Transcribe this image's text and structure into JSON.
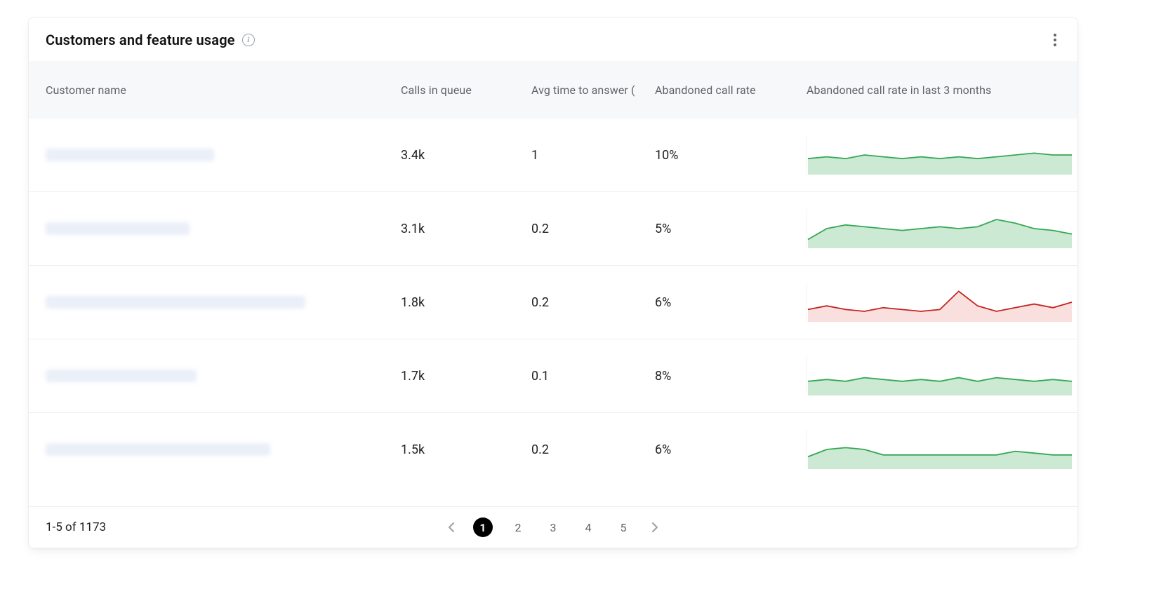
{
  "card": {
    "title": "Customers and feature usage",
    "columns": {
      "name": "Customer name",
      "calls": "Calls in queue",
      "avg": "Avg time to answer (",
      "rate": "Abandoned call rate",
      "chart": "Abandoned call rate in last 3 months"
    }
  },
  "rows": [
    {
      "name_blur_width": 240,
      "calls": "3.4k",
      "avg_answer": "1",
      "abandoned_rate": "10%",
      "chart_color": "green",
      "series": [
        8,
        9,
        8,
        10,
        9,
        8,
        9,
        8,
        9,
        8,
        9,
        10,
        11,
        10,
        10
      ]
    },
    {
      "name_blur_width": 205,
      "calls": "3.1k",
      "avg_answer": "0.2",
      "abandoned_rate": "5%",
      "chart_color": "green",
      "series": [
        4,
        10,
        12,
        11,
        10,
        9,
        10,
        11,
        10,
        11,
        15,
        13,
        10,
        9,
        7
      ]
    },
    {
      "name_blur_width": 370,
      "calls": "1.8k",
      "avg_answer": "0.2",
      "abandoned_rate": "6%",
      "chart_color": "red",
      "series": [
        6,
        8,
        6,
        5,
        7,
        6,
        5,
        6,
        16,
        8,
        5,
        7,
        9,
        7,
        10
      ]
    },
    {
      "name_blur_width": 215,
      "calls": "1.7k",
      "avg_answer": "0.1",
      "abandoned_rate": "8%",
      "chart_color": "green",
      "series": [
        7,
        8,
        7,
        9,
        8,
        7,
        8,
        7,
        9,
        7,
        9,
        8,
        7,
        8,
        7
      ]
    },
    {
      "name_blur_width": 320,
      "calls": "1.5k",
      "avg_answer": "0.2",
      "abandoned_rate": "6%",
      "chart_color": "green",
      "series": [
        6,
        10,
        11,
        10,
        7,
        7,
        7,
        7,
        7,
        7,
        7,
        9,
        8,
        7,
        7
      ]
    }
  ],
  "pagination": {
    "range_text": "1-5 of 1173",
    "pages": [
      "1",
      "2",
      "3",
      "4",
      "5"
    ],
    "active_page": "1"
  },
  "chart_data": [
    {
      "type": "area",
      "color": "green",
      "title": "Abandoned call rate in last 3 months",
      "values": [
        8,
        9,
        8,
        10,
        9,
        8,
        9,
        8,
        9,
        8,
        9,
        10,
        11,
        10,
        10
      ],
      "ylim": [
        0,
        20
      ],
      "xlabel": "",
      "ylabel": ""
    },
    {
      "type": "area",
      "color": "green",
      "title": "Abandoned call rate in last 3 months",
      "values": [
        4,
        10,
        12,
        11,
        10,
        9,
        10,
        11,
        10,
        11,
        15,
        13,
        10,
        9,
        7
      ],
      "ylim": [
        0,
        20
      ],
      "xlabel": "",
      "ylabel": ""
    },
    {
      "type": "area",
      "color": "red",
      "title": "Abandoned call rate in last 3 months",
      "values": [
        6,
        8,
        6,
        5,
        7,
        6,
        5,
        6,
        16,
        8,
        5,
        7,
        9,
        7,
        10
      ],
      "ylim": [
        0,
        20
      ],
      "xlabel": "",
      "ylabel": ""
    },
    {
      "type": "area",
      "color": "green",
      "title": "Abandoned call rate in last 3 months",
      "values": [
        7,
        8,
        7,
        9,
        8,
        7,
        8,
        7,
        9,
        7,
        9,
        8,
        7,
        8,
        7
      ],
      "ylim": [
        0,
        20
      ],
      "xlabel": "",
      "ylabel": ""
    },
    {
      "type": "area",
      "color": "green",
      "title": "Abandoned call rate in last 3 months",
      "values": [
        6,
        10,
        11,
        10,
        7,
        7,
        7,
        7,
        7,
        7,
        7,
        9,
        8,
        7,
        7
      ],
      "ylim": [
        0,
        20
      ],
      "xlabel": "",
      "ylabel": ""
    }
  ]
}
